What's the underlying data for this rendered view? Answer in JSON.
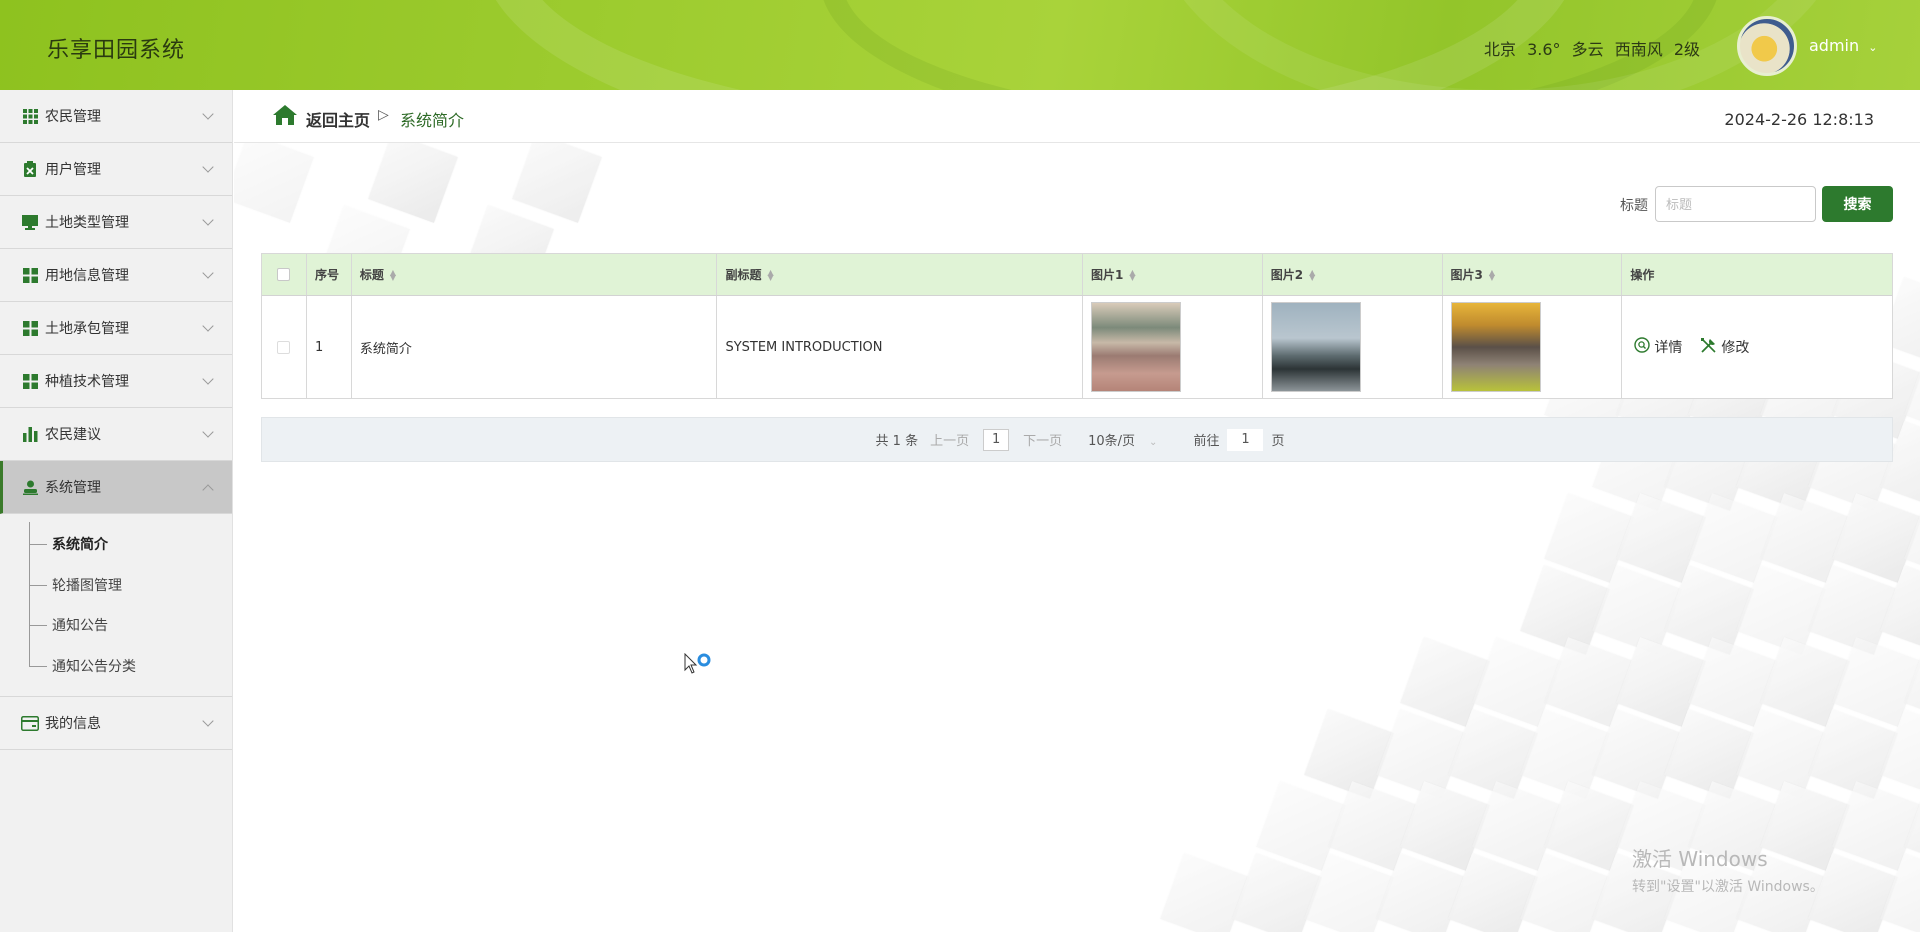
{
  "app": {
    "title": "乐享田园系统"
  },
  "header": {
    "weather": {
      "city": "北京",
      "temp": "3.6°",
      "condition": "多云",
      "wind": "西南风",
      "level": "2级"
    },
    "user": {
      "name": "admin"
    }
  },
  "sidebar": {
    "items": [
      {
        "label": "农民管理",
        "icon": "grid-icon"
      },
      {
        "label": "用户管理",
        "icon": "clipboard-icon"
      },
      {
        "label": "土地类型管理",
        "icon": "monitor-icon"
      },
      {
        "label": "用地信息管理",
        "icon": "dashboard-icon"
      },
      {
        "label": "土地承包管理",
        "icon": "dashboard-icon"
      },
      {
        "label": "种植技术管理",
        "icon": "dashboard-icon"
      },
      {
        "label": "农民建议",
        "icon": "bar-chart-icon"
      },
      {
        "label": "系统管理",
        "icon": "user-icon",
        "expanded": true
      },
      {
        "label": "我的信息",
        "icon": "card-icon"
      }
    ],
    "submenu": [
      {
        "label": "系统简介",
        "active": true
      },
      {
        "label": "轮播图管理"
      },
      {
        "label": "通知公告"
      },
      {
        "label": "通知公告分类"
      }
    ]
  },
  "breadcrumb": {
    "home": "返回主页",
    "separator": "▷",
    "current": "系统简介"
  },
  "datetime": "2024-2-26 12:8:13",
  "search": {
    "label": "标题",
    "placeholder": "标题",
    "button": "搜索"
  },
  "table": {
    "headers": {
      "no": "序号",
      "title": "标题",
      "subtitle": "副标题",
      "img1": "图片1",
      "img2": "图片2",
      "img3": "图片3",
      "ops": "操作"
    },
    "rows": [
      {
        "no": "1",
        "title": "系统简介",
        "subtitle": "SYSTEM INTRODUCTION"
      }
    ],
    "actions": {
      "detail": "详情",
      "edit": "修改"
    }
  },
  "pager": {
    "total": "共 1 条",
    "prev": "上一页",
    "current": "1",
    "next": "下一页",
    "size": "10条/页",
    "goto_prefix": "前往",
    "goto_value": "1",
    "goto_suffix": "页"
  },
  "watermark": {
    "line1": "激活 Windows",
    "line2": "转到\"设置\"以激活 Windows。"
  },
  "colors": {
    "brand_green": "#2d7a2e",
    "header_green": "#9ccb2e",
    "table_head": "#e0f3d6"
  }
}
